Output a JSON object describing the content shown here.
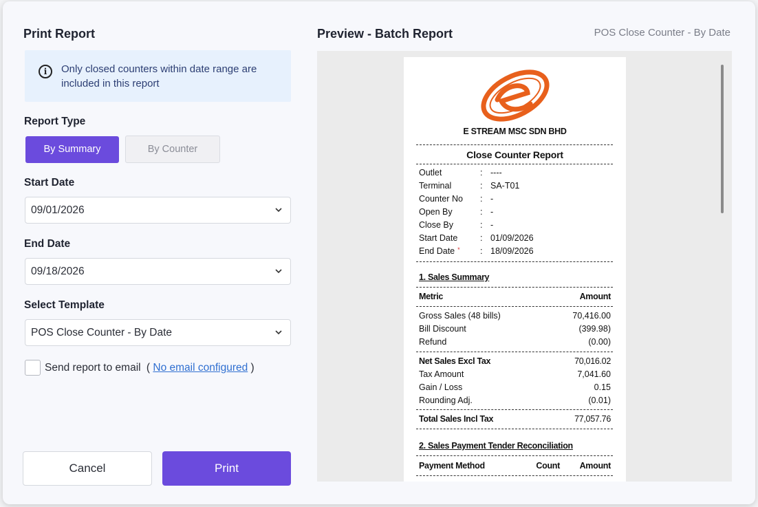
{
  "dialog": {
    "title": "Print Report",
    "info_text": "Only closed counters within date range are included in this report",
    "report_type": {
      "label": "Report Type",
      "options": [
        "By Summary",
        "By Counter"
      ],
      "selected": "By Summary"
    },
    "start_date": {
      "label": "Start Date",
      "value": "09/01/2026"
    },
    "end_date": {
      "label": "End Date",
      "value": "09/18/2026"
    },
    "template": {
      "label": "Select Template",
      "value": "POS Close Counter - By Date"
    },
    "email": {
      "label": "Send report to email",
      "open_paren": "(",
      "link": "No email configured",
      "close_paren": ")",
      "checked": false
    },
    "buttons": {
      "cancel": "Cancel",
      "print": "Print"
    }
  },
  "preview": {
    "title": "Preview - Batch Report",
    "subtitle": "POS Close Counter - By Date",
    "receipt": {
      "company": "E STREAM MSC SDN BHD",
      "report_title": "Close Counter Report",
      "fields": [
        {
          "key": "Outlet",
          "value": "----"
        },
        {
          "key": "Terminal",
          "value": "SA-T01"
        },
        {
          "key": "Counter No",
          "value": "-"
        },
        {
          "key": "Open By",
          "value": "-"
        },
        {
          "key": "Close By",
          "value": "-"
        },
        {
          "key": "Start Date",
          "value": "01/09/2026"
        },
        {
          "key": "End Date",
          "value": "18/09/2026"
        }
      ],
      "separator": ":",
      "required_mark": "*",
      "section1": {
        "title": "1. Sales Summary",
        "col_metric": "Metric",
        "col_amount": "Amount",
        "rows1": [
          {
            "label": "Gross Sales (48 bills)",
            "amount": "70,416.00"
          },
          {
            "label": "Bill Discount",
            "amount": "(399.98)"
          },
          {
            "label": "Refund",
            "amount": "(0.00)"
          }
        ],
        "net_label": "Net Sales Excl Tax",
        "net_amount": "70,016.02",
        "rows2": [
          {
            "label": "Tax Amount",
            "amount": "7,041.60"
          },
          {
            "label": "Gain / Loss",
            "amount": "0.15"
          },
          {
            "label": "Rounding Adj.",
            "amount": "(0.01)"
          }
        ],
        "total_label": "Total Sales Incl Tax",
        "total_amount": "77,057.76"
      },
      "section2": {
        "title": "2. Sales Payment Tender Reconciliation",
        "col_method": "Payment Method",
        "col_count": "Count",
        "col_amount": "Amount"
      }
    }
  },
  "colors": {
    "accent": "#6b4bdd",
    "logo": "#e8601c",
    "link": "#2f6fd1",
    "info_bg": "#e7f1fd"
  }
}
